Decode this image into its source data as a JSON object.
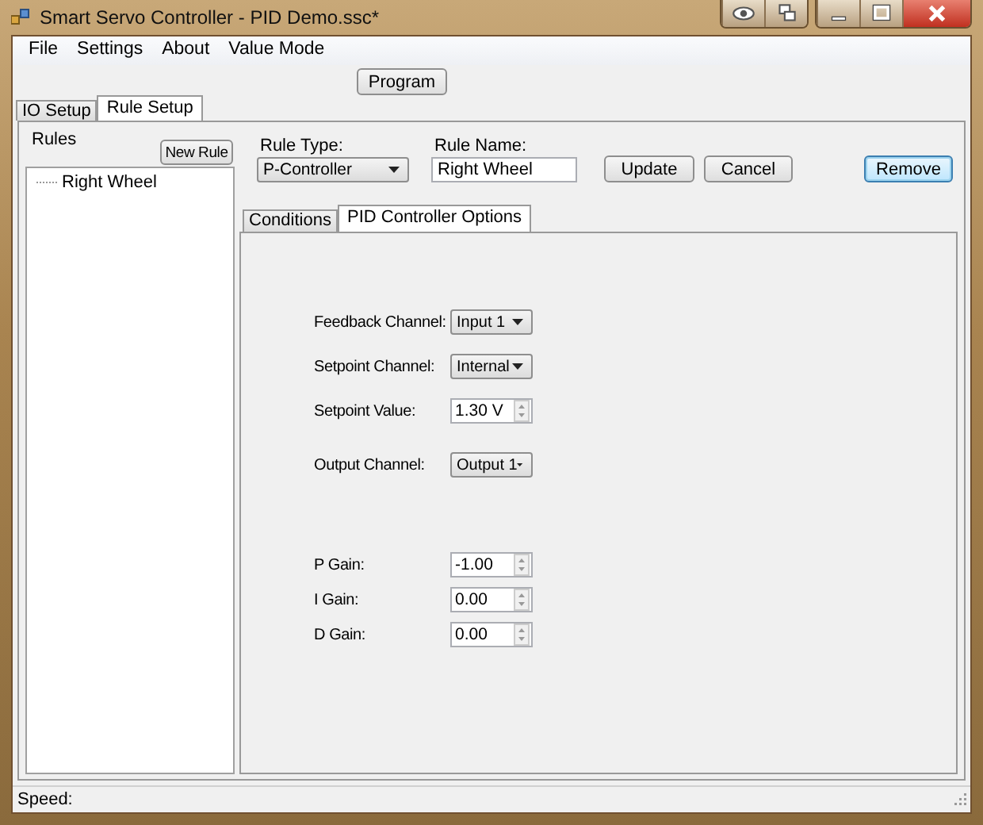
{
  "window": {
    "title": "Smart Servo Controller - PID Demo.ssc*"
  },
  "menu": [
    "File",
    "Settings",
    "About",
    "Value Mode"
  ],
  "toolbar": {
    "program_button": "Program"
  },
  "tabs": [
    {
      "label": "IO Setup",
      "selected": false
    },
    {
      "label": "Rule Setup",
      "selected": true
    }
  ],
  "rules": {
    "title": "Rules",
    "new_button": "New Rule",
    "items": [
      {
        "label": "Right Wheel"
      }
    ]
  },
  "rule_type": {
    "label": "Rule Type:",
    "value": "P-Controller"
  },
  "rule_name": {
    "label": "Rule Name:",
    "value": "Right Wheel"
  },
  "buttons": [
    {
      "label": "Update",
      "default": false
    },
    {
      "label": "Cancel",
      "default": false
    },
    {
      "label": "Remove",
      "default": true
    }
  ],
  "inner_tabs": [
    {
      "label": "Conditions",
      "selected": false
    },
    {
      "label": "PID Controller Options",
      "selected": true
    }
  ],
  "groups": [
    [
      {
        "label": "Feedback Channel:",
        "kind": "dropdown",
        "value": "Input 1"
      },
      {
        "label": "Setpoint Channel:",
        "kind": "dropdown",
        "value": "Internal"
      },
      {
        "label": "Setpoint Value:",
        "kind": "spin",
        "value": "1.30 V"
      },
      {
        "label": "Output Channel:",
        "kind": "dropdown",
        "value": "Output 1"
      }
    ],
    [
      {
        "label": "P Gain:",
        "kind": "spin",
        "value": "-1.00"
      },
      {
        "label": "I Gain:",
        "kind": "spin",
        "value": "0.00"
      },
      {
        "label": "D Gain:",
        "kind": "spin",
        "value": "0.00"
      }
    ]
  ],
  "status_bar": {
    "label": "Speed:"
  }
}
